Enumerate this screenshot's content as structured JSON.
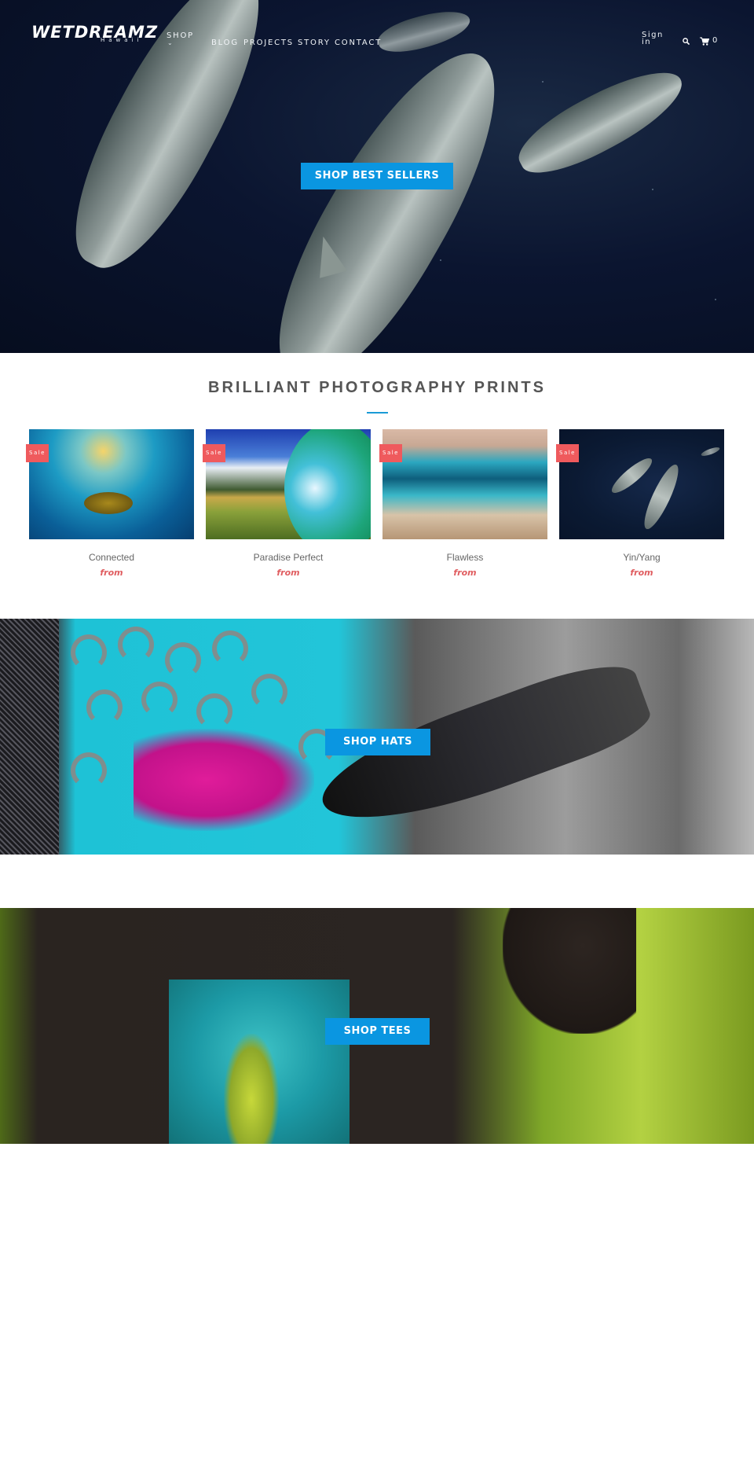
{
  "header": {
    "logo": "WETDREAMZ",
    "logo_sub": "Hawaii",
    "nav": [
      {
        "label": "Shop",
        "has_dropdown": true
      },
      {
        "label": "Blog"
      },
      {
        "label": "Projects"
      },
      {
        "label": "Story"
      },
      {
        "label": "Contact"
      }
    ],
    "sign_in": "Sign in",
    "search_icon": "search-icon",
    "cart_icon": "cart-icon",
    "cart_count": "0"
  },
  "hero": {
    "cta_label": "SHOP BEST SELLERS"
  },
  "featured": {
    "title": "BRILLIANT PHOTOGRAPHY PRINTS",
    "products": [
      {
        "name": "Connected",
        "badge": "Sale",
        "price_label": "from"
      },
      {
        "name": "Paradise Perfect",
        "badge": "Sale",
        "price_label": "from"
      },
      {
        "name": "Flawless",
        "badge": "Sale",
        "price_label": "from"
      },
      {
        "name": "Yin/Yang",
        "badge": "Sale",
        "price_label": "from"
      }
    ]
  },
  "banners": {
    "hats_cta": "SHOP HATS",
    "tees_cta": "SHOP TEES"
  },
  "colors": {
    "accent": "#0a96e1",
    "sale_badge": "#ef5a5d",
    "price": "#e05d60",
    "title_rule": "#1a9bd6"
  }
}
